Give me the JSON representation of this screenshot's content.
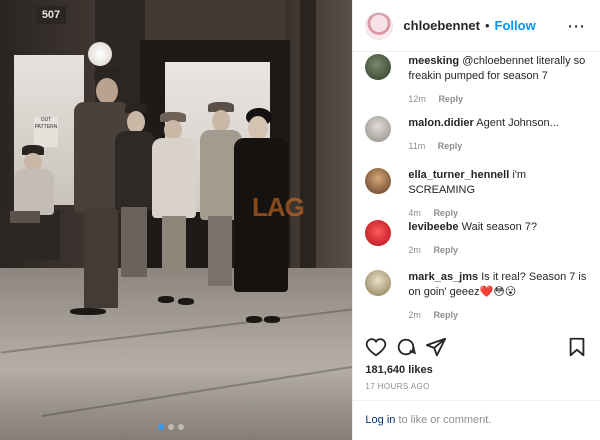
{
  "photo": {
    "address_number": "507",
    "sign_text": "OUT PATTERN",
    "watermark": "LAG",
    "carousel_dots": 3,
    "active_dot": 0
  },
  "post": {
    "username": "chloebennet",
    "follow_label": "Follow",
    "separator": "•"
  },
  "comments": [
    {
      "username": "meesking",
      "text": "@chloebennet literally so freakin pumped for season 7",
      "time": "12m",
      "reply_label": "Reply"
    },
    {
      "username": "malon.didier",
      "text": "Agent Johnson...",
      "time": "11m",
      "reply_label": "Reply"
    },
    {
      "username": "ella_turner_hennell",
      "text": "i'm SCREAMING",
      "time": "4m",
      "reply_label": "Reply"
    },
    {
      "username": "levibeebe",
      "text": "Wait season 7?",
      "time": "2m",
      "reply_label": "Reply"
    },
    {
      "username": "mark_as_jms",
      "text": "Is it real? Season 7 is on goin' geeez❤️😳😮",
      "time": "2m",
      "reply_label": "Reply"
    }
  ],
  "stats": {
    "likes": "181,640 likes",
    "posted": "17 HOURS AGO"
  },
  "footer": {
    "login_link": "Log in",
    "login_rest": " to like or comment."
  },
  "icons": {
    "like": "heart-icon",
    "comment": "comment-icon",
    "share": "share-icon",
    "save": "bookmark-icon",
    "more": "more-options-icon"
  },
  "colors": {
    "follow_blue": "#0095f6",
    "text": "#262626",
    "secondary": "#8e8e8e",
    "link": "#00376b"
  }
}
